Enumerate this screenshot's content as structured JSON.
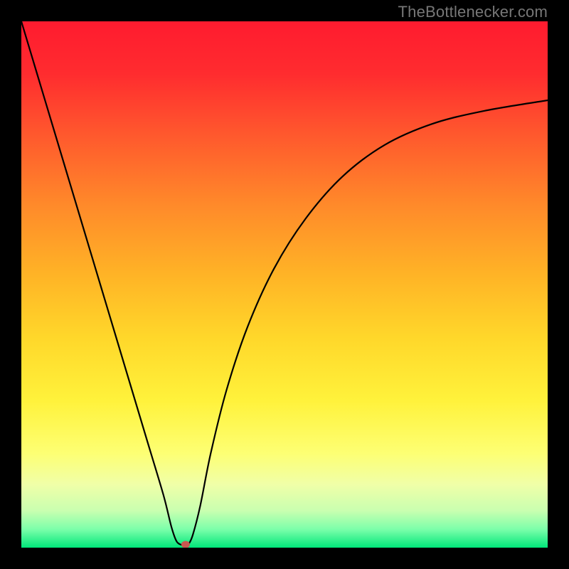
{
  "watermark": "TheBottlenecker.com",
  "chart_data": {
    "type": "line",
    "title": "",
    "xlabel": "",
    "ylabel": "",
    "xlim": [
      0,
      100
    ],
    "ylim": [
      0,
      100
    ],
    "grid": false,
    "legend": false,
    "background_gradient": {
      "stops": [
        {
          "offset": 0.0,
          "color": "#ff1b2f"
        },
        {
          "offset": 0.1,
          "color": "#ff2c2f"
        },
        {
          "offset": 0.22,
          "color": "#ff5a2d"
        },
        {
          "offset": 0.35,
          "color": "#ff8a2a"
        },
        {
          "offset": 0.48,
          "color": "#ffb326"
        },
        {
          "offset": 0.6,
          "color": "#ffd72a"
        },
        {
          "offset": 0.72,
          "color": "#fff23b"
        },
        {
          "offset": 0.82,
          "color": "#fdff73"
        },
        {
          "offset": 0.88,
          "color": "#f0ffa8"
        },
        {
          "offset": 0.93,
          "color": "#c9ffb0"
        },
        {
          "offset": 0.965,
          "color": "#7cffaa"
        },
        {
          "offset": 1.0,
          "color": "#00e77a"
        }
      ]
    },
    "series": [
      {
        "name": "bottleneck-curve",
        "color": "#000000",
        "stroke_width": 2.2,
        "x": [
          0,
          3,
          6,
          9,
          12,
          15,
          18,
          21,
          24,
          27,
          28.5,
          29.5,
          30.5,
          31.2,
          31.8,
          32.6,
          34,
          36,
          39,
          43,
          48,
          54,
          61,
          69,
          78,
          88,
          100
        ],
        "y": [
          100,
          90,
          80,
          70,
          60,
          50,
          40,
          30,
          20,
          10,
          4,
          1.2,
          0.5,
          0.3,
          0.7,
          2.5,
          8,
          18,
          30,
          42,
          53,
          62.5,
          70.5,
          76.5,
          80.5,
          83,
          85
        ]
      }
    ],
    "marker": {
      "name": "target-marker",
      "x": 31.2,
      "y": 0.6,
      "rx": 6,
      "ry": 5,
      "color": "#c85850"
    }
  }
}
